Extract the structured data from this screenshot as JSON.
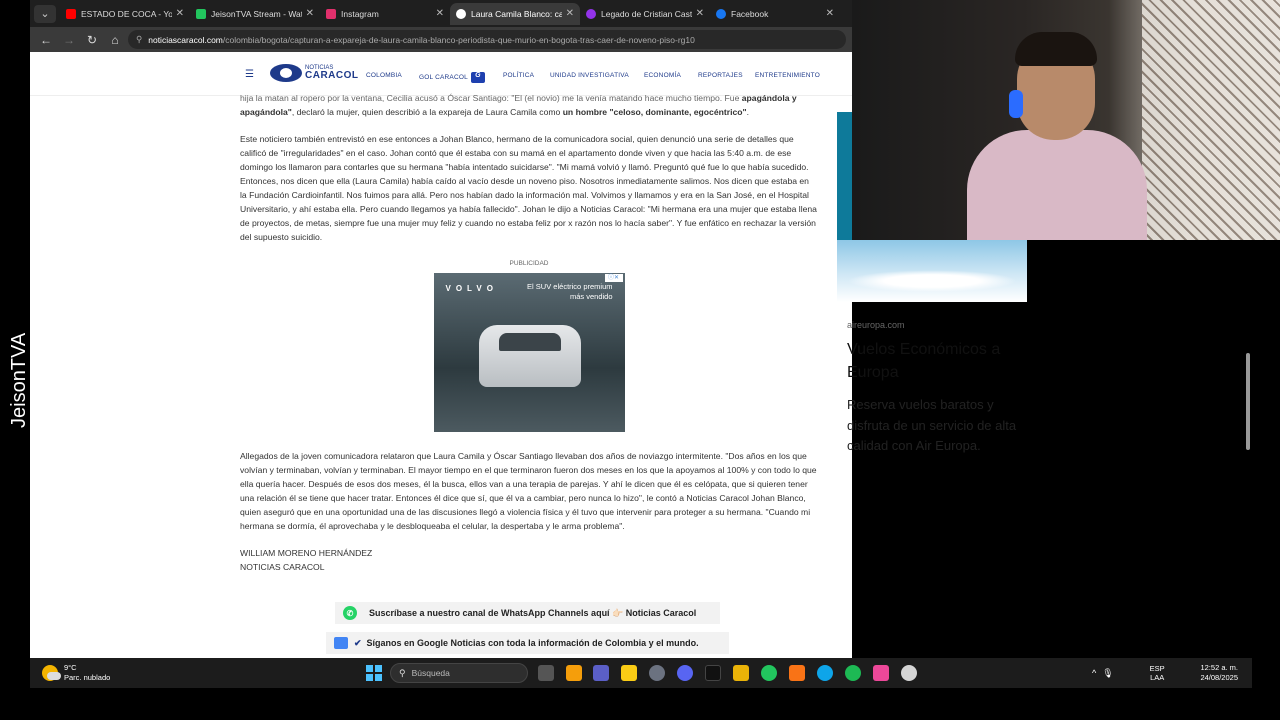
{
  "browser": {
    "tabs": [
      {
        "title": "ESTADO DE COCA - YouTube",
        "color": "#ff0000",
        "active": false
      },
      {
        "title": "JeisonTVA Stream - Watch",
        "color": "#22c55e",
        "active": false
      },
      {
        "title": "Instagram",
        "color": "#e1306c",
        "active": false
      },
      {
        "title": "Laura Camila Blanco: capt",
        "color": "#1e3a8a",
        "active": true
      },
      {
        "title": "Legado de Cristian Castañ",
        "color": "#9333ea",
        "active": false
      },
      {
        "title": "Facebook",
        "color": "#1877f2",
        "active": false
      }
    ],
    "url_domain": "noticiascaracol.com",
    "url_path": "/colombia/bogota/capturan-a-expareja-de-laura-camila-blanco-periodista-que-murio-en-bogota-tras-caer-de-noveno-piso-rg10"
  },
  "site": {
    "logo_small": "NOTICIAS",
    "logo_big": "CARACOL",
    "nav": [
      "COLOMBIA",
      "GOL CARACOL",
      "POLÍTICA",
      "UNIDAD INVESTIGATIVA",
      "ECONOMÍA",
      "REPORTAJES",
      "ENTRETENIMIENTO"
    ],
    "gol_badge": "G"
  },
  "article": {
    "p1_cut": "hija la matan al ropero por la ventana, Cecilia acusó a Óscar Santiago: \"El (el novio) me la venía matando hace mucho tiempo. Fue",
    "p1_bold": "apagándola y apagándola\"",
    "p1_mid": ", declaró la mujer, quien describió a la expareja de Laura Camila como ",
    "p1_bold2": "un hombre \"celoso, dominante, egocéntrico\"",
    "p1_end": ".",
    "p2": "Este noticiero también entrevistó en ese entonces a Johan Blanco, hermano de la comunicadora social, quien denunció una serie de detalles que calificó de \"irregularidades\" en el caso. Johan contó que él estaba con su mamá en el apartamento donde viven y que hacia las 5:40 a.m. de ese domingo los llamaron para contarles que su hermana \"había intentado suicidarse\". \"Mi mamá volvió y llamó. Preguntó qué fue lo que había sucedido. Entonces, nos dicen que ella (Laura Camila) había caído al vacío desde un noveno piso. Nosotros inmediatamente salimos. Nos dicen que estaba en la Fundación Cardioinfantil. Nos fuimos para allá. Pero nos habían dado la información mal. Volvimos y llamamos y era en la San José, en el Hospital Universitario, y ahí estaba ella. Pero cuando llegamos ya había fallecido\". Johan le dijo a Noticias Caracol: \"Mi hermana era una mujer que estaba llena de proyectos, de metas, siempre fue una mujer muy feliz y cuando no estaba feliz por x razón nos lo hacía saber\". Y fue enfático en rechazar la versión del supuesto suicidio.",
    "ad_label": "PUBLICIDAD",
    "ad_brand": "VOLVO",
    "ad_tagline": "El SUV eléctrico premium más vendido",
    "p3": "Allegados de la joven comunicadora relataron que Laura Camila y Óscar Santiago llevaban dos años de noviazgo intermitente. \"Dos años en los que volvían y terminaban, volvían y terminaban. El mayor tiempo en el que terminaron fueron dos meses en los que la apoyamos al 100% y con todo lo que ella quería hacer. Después de esos dos meses, él la busca, ellos van a una terapia de parejas. Y ahí le dicen que él es celópata, que si quieren tener una relación él se tiene que hacer tratar. Entonces él dice que sí, que él va a cambiar, pero nunca lo hizo\", le contó a Noticias Caracol Johan Blanco, quien aseguró que en una oportunidad una de las discusiones llegó a violencia física y él tuvo que intervenir para proteger a su hermana. \"Cuando mi hermana se dormía, él aprovechaba y le desbloqueaba el celular, la despertaba y le arma problema\".",
    "author_name": "WILLIAM MORENO HERNÁNDEZ",
    "author_org": "NOTICIAS CARACOL"
  },
  "banners": {
    "whatsapp": "Suscríbase a nuestro canal de WhatsApp Channels aquí 👉🏻 Noticias Caracol",
    "google": "Síganos en Google Noticias con toda la información de Colombia y el mundo."
  },
  "sidebar_ad": {
    "source": "aireuropa.com",
    "title": "Vuelos Económicos a Europa",
    "description": "Reserva vuelos baratos y disfruta de un servicio de alta calidad con Air Europa."
  },
  "overlay": {
    "watermark": "JeisonTVA"
  },
  "taskbar": {
    "temp": "9°C",
    "weather": "Parc. nublado",
    "search_placeholder": "Búsqueda",
    "lang_top": "ESP",
    "lang_bottom": "LAA",
    "time": "12:52 a. m.",
    "date": "24/08/2025"
  }
}
